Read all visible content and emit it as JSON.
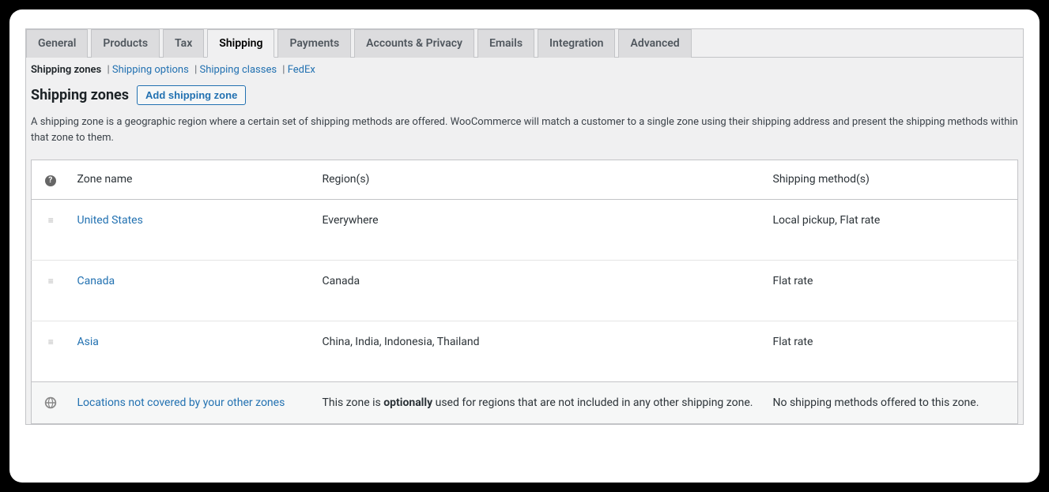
{
  "tabs": {
    "general": "General",
    "products": "Products",
    "tax": "Tax",
    "shipping": "Shipping",
    "payments": "Payments",
    "accounts": "Accounts & Privacy",
    "emails": "Emails",
    "integration": "Integration",
    "advanced": "Advanced"
  },
  "subnav": {
    "zones": "Shipping zones",
    "options": "Shipping options",
    "classes": "Shipping classes",
    "fedex": "FedEx"
  },
  "page": {
    "title": "Shipping zones",
    "add_button": "Add shipping zone",
    "description": "A shipping zone is a geographic region where a certain set of shipping methods are offered. WooCommerce will match a customer to a single zone using their shipping address and present the shipping methods within that zone to them."
  },
  "table": {
    "col_name": "Zone name",
    "col_region": "Region(s)",
    "col_method": "Shipping method(s)",
    "help_glyph": "?"
  },
  "zones": [
    {
      "name": "United States",
      "region": "Everywhere",
      "method": "Local pickup, Flat rate"
    },
    {
      "name": "Canada",
      "region": "Canada",
      "method": "Flat rate"
    },
    {
      "name": "Asia",
      "region": "China, India, Indonesia, Thailand",
      "method": "Flat rate"
    }
  ],
  "footer": {
    "name": "Locations not covered by your other zones",
    "desc_prefix": "This zone is ",
    "desc_strong": "optionally",
    "desc_suffix": " used for regions that are not included in any other shipping zone.",
    "method": "No shipping methods offered to this zone."
  }
}
